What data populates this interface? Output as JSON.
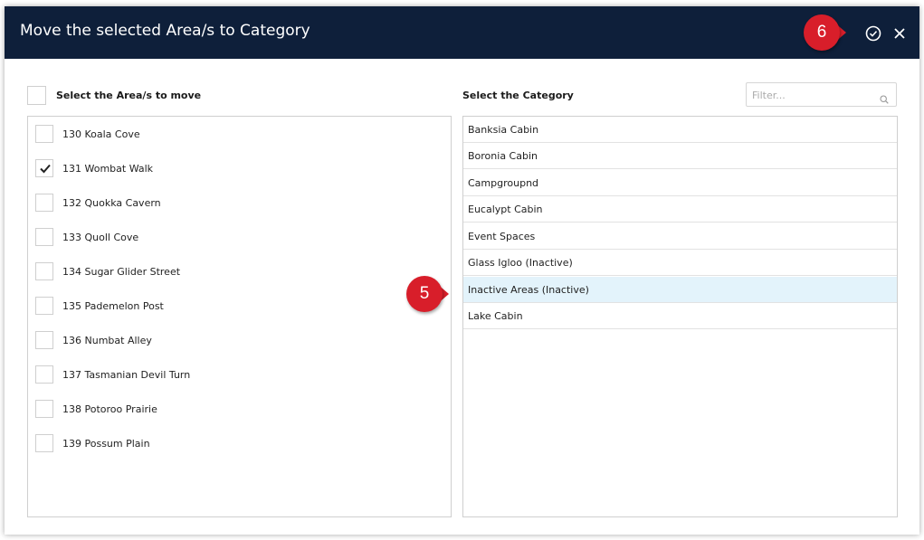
{
  "dialog": {
    "title": "Move the selected Area/s to Category",
    "confirm_icon": "check-circle-icon",
    "close_icon": "close-icon"
  },
  "callouts": [
    {
      "number": "6"
    },
    {
      "number": "5"
    }
  ],
  "areas": {
    "label": "Select the Area/s to move",
    "items": [
      {
        "label": "130 Koala Cove",
        "checked": false
      },
      {
        "label": "131 Wombat Walk",
        "checked": true
      },
      {
        "label": "132 Quokka Cavern",
        "checked": false
      },
      {
        "label": "133 Quoll Cove",
        "checked": false
      },
      {
        "label": "134 Sugar Glider Street",
        "checked": false
      },
      {
        "label": "135 Pademelon Post",
        "checked": false
      },
      {
        "label": "136 Numbat Alley",
        "checked": false
      },
      {
        "label": "137 Tasmanian Devil Turn",
        "checked": false
      },
      {
        "label": "138 Potoroo Prairie",
        "checked": false
      },
      {
        "label": "139 Possum Plain",
        "checked": false
      }
    ]
  },
  "categories": {
    "label": "Select the Category",
    "filter_placeholder": "Filter...",
    "items": [
      {
        "label": "Banksia Cabin",
        "selected": false
      },
      {
        "label": "Boronia Cabin",
        "selected": false
      },
      {
        "label": "Campgroupnd",
        "selected": false
      },
      {
        "label": "Eucalypt Cabin",
        "selected": false
      },
      {
        "label": "Event Spaces",
        "selected": false
      },
      {
        "label": "Glass Igloo (Inactive)",
        "selected": false
      },
      {
        "label": "Inactive Areas (Inactive)",
        "selected": true
      },
      {
        "label": "Lake Cabin",
        "selected": false
      }
    ]
  },
  "colors": {
    "header_bg": "#0e1f3a",
    "callout": "#d81e2a",
    "selected_row": "#e3f3fb"
  }
}
